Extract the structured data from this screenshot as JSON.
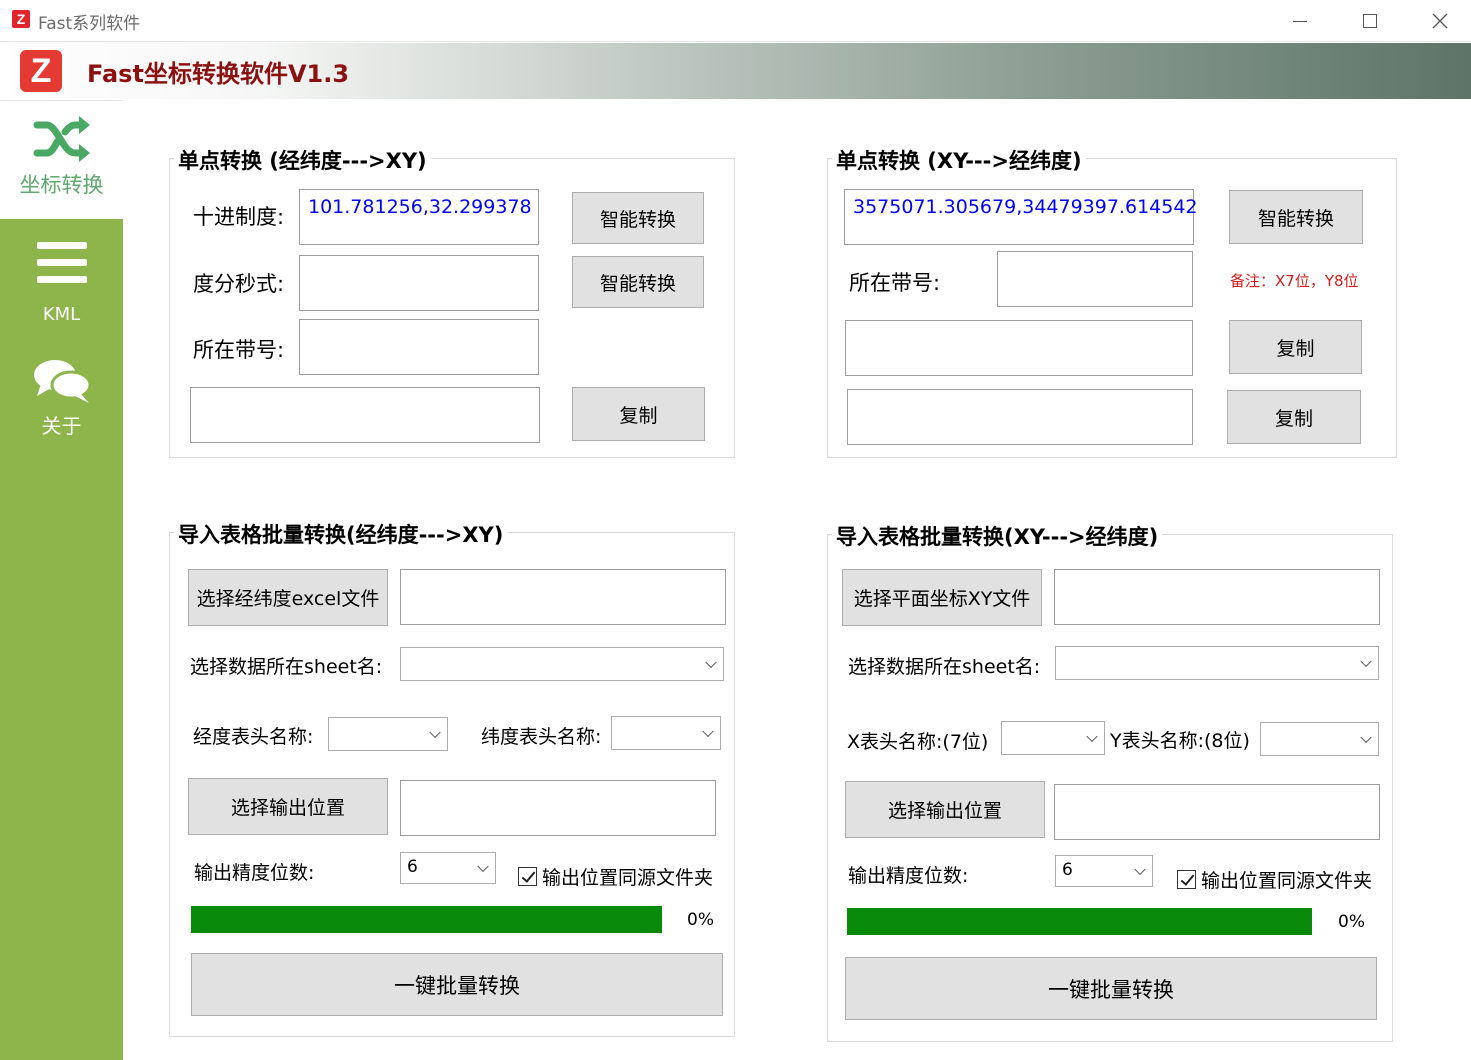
{
  "window": {
    "title": "Fast系列软件",
    "app_icon_letter": "Z"
  },
  "header": {
    "title": "Fast坐标转换软件V1.3",
    "logo_letter": "Z"
  },
  "sidebar": {
    "items": [
      {
        "label": "坐标转换",
        "icon": "shuffle-icon",
        "active": true
      },
      {
        "label": "KML",
        "icon": "menu-icon",
        "active": false
      },
      {
        "label": "关于",
        "icon": "chat-bubbles-icon",
        "active": false
      }
    ]
  },
  "single_ll_to_xy": {
    "title": "单点转换 (经纬度--->XY)",
    "decimal_label": "十进制度:",
    "decimal_value": "101.781256,32.299378",
    "dms_label": "度分秒式:",
    "dms_value": "",
    "zone_label": "所在带号:",
    "zone_value": "",
    "result_value": "",
    "smart_btn_1": "智能转换",
    "smart_btn_2": "智能转换",
    "copy_btn": "复制"
  },
  "single_xy_to_ll": {
    "title": "单点转换 (XY--->经纬度)",
    "xy_value": "3575071.305679,34479397.614542",
    "smart_btn": "智能转换",
    "zone_label": "所在带号:",
    "zone_value": "",
    "note": "备注：X7位，Y8位",
    "result1_value": "",
    "result2_value": "",
    "copy_btn_1": "复制",
    "copy_btn_2": "复制"
  },
  "batch_ll_to_xy": {
    "title": "导入表格批量转换(经纬度--->XY)",
    "select_file_btn": "选择经纬度excel文件",
    "file_path": "",
    "sheet_label": "选择数据所在sheet名:",
    "sheet_value": "",
    "lon_header_label": "经度表头名称:",
    "lon_header_value": "",
    "lat_header_label": "纬度表头名称:",
    "lat_header_value": "",
    "output_btn": "选择输出位置",
    "output_path": "",
    "precision_label": "输出精度位数:",
    "precision_value": "6",
    "same_folder_label": "输出位置同源文件夹",
    "progress_percent": 0,
    "progress_text": "0%",
    "run_btn": "一键批量转换"
  },
  "batch_xy_to_ll": {
    "title": "导入表格批量转换(XY--->经纬度)",
    "select_file_btn": "选择平面坐标XY文件",
    "file_path": "",
    "sheet_label": "选择数据所在sheet名:",
    "sheet_value": "",
    "x_header_label": "X表头名称:(7位)",
    "x_header_value": "",
    "y_header_label": "Y表头名称:(8位)",
    "y_header_value": "",
    "output_btn": "选择输出位置",
    "output_path": "",
    "precision_label": "输出精度位数:",
    "precision_value": "6",
    "same_folder_label": "输出位置同源文件夹",
    "progress_percent": 0,
    "progress_text": "0%",
    "run_btn": "一键批量转换"
  },
  "colors": {
    "sidebar": "#8db54b",
    "active_nav_text": "#61a86f",
    "title_red": "#8b1111",
    "progress": "#0a8a0a",
    "note_red": "#d21d1d",
    "value_blue": "#0000ff"
  }
}
